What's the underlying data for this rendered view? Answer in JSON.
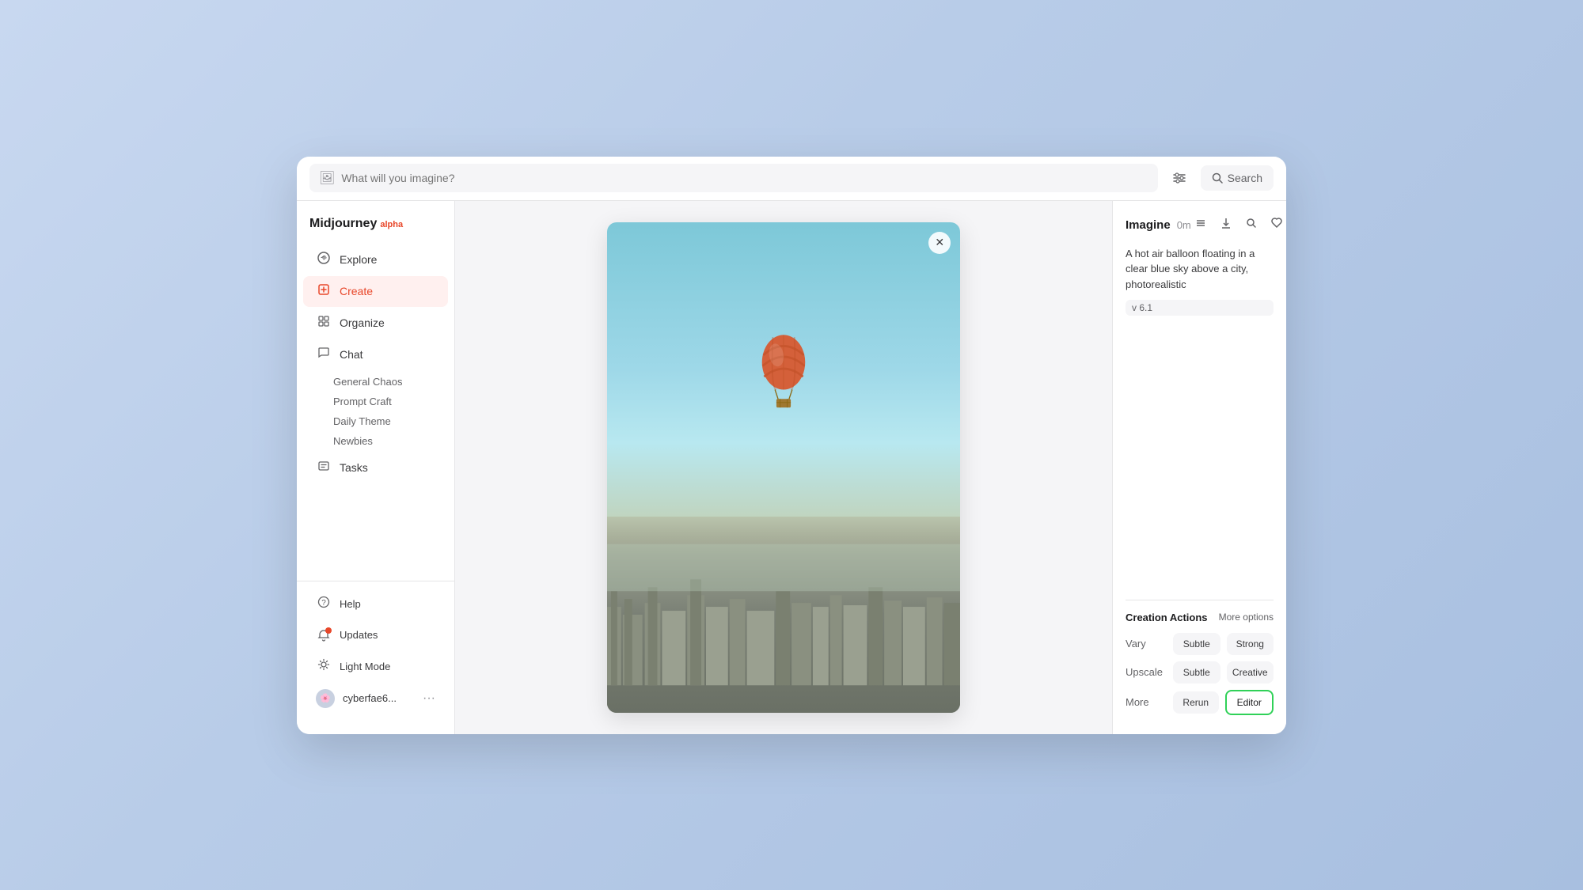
{
  "app": {
    "name": "Midjourney",
    "alpha_label": "alpha"
  },
  "header": {
    "input_placeholder": "What will you imagine?",
    "search_label": "Search"
  },
  "sidebar": {
    "nav_items": [
      {
        "id": "explore",
        "label": "Explore",
        "icon": "compass"
      },
      {
        "id": "create",
        "label": "Create",
        "icon": "create",
        "active": true
      },
      {
        "id": "organize",
        "label": "Organize",
        "icon": "grid"
      },
      {
        "id": "chat",
        "label": "Chat",
        "icon": "chat"
      },
      {
        "id": "tasks",
        "label": "Tasks",
        "icon": "tasks"
      }
    ],
    "chat_sub_items": [
      {
        "id": "general-chaos",
        "label": "General Chaos"
      },
      {
        "id": "prompt-craft",
        "label": "Prompt Craft"
      },
      {
        "id": "daily-theme",
        "label": "Daily Theme"
      },
      {
        "id": "newbies",
        "label": "Newbies"
      }
    ],
    "bottom_items": [
      {
        "id": "help",
        "label": "Help",
        "icon": "help"
      },
      {
        "id": "updates",
        "label": "Updates",
        "icon": "updates",
        "has_dot": true
      },
      {
        "id": "light-mode",
        "label": "Light Mode",
        "icon": "light"
      }
    ],
    "user": {
      "name": "cyberfae6...",
      "avatar": "🌸"
    }
  },
  "right_panel": {
    "title": "Imagine",
    "time": "0m",
    "description": "A hot air balloon floating in a clear blue sky above a city, photorealistic",
    "version": "v 6.1",
    "creation_actions": {
      "title": "Creation Actions",
      "more_options": "More options",
      "vary_label": "Vary",
      "upscale_label": "Upscale",
      "more_label": "More",
      "subtle_label": "Subtle",
      "strong_label": "Strong",
      "creative_label": "Creative",
      "rerun_label": "Rerun",
      "editor_label": "Editor"
    }
  },
  "colors": {
    "accent": "#e8472a",
    "green": "#30d158",
    "active_bg": "#fff0ef"
  }
}
